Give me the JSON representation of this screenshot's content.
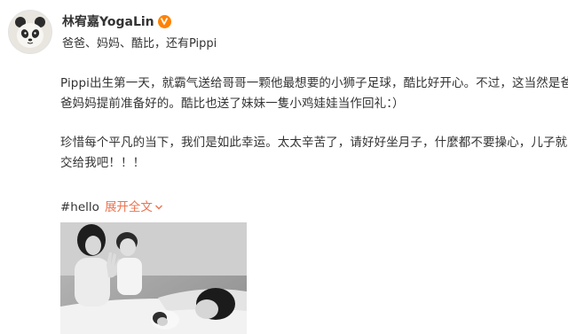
{
  "post": {
    "author": {
      "name": "林宥嘉YogaLin",
      "avatar_icon": "panda-avatar-icon",
      "badge_icon": "verified-badge-icon"
    },
    "subtitle": "爸爸、妈妈、酷比，还有Pippi",
    "paragraph1": [
      "Pippi出生第一天，就霸气送给哥哥一颗他最想要的小狮子足球，酷比好开心。不过，这当然是爸",
      "爸妈妈提前准备好的。酷比也送了妹妹一隻小鸡娃娃当作回礼：）"
    ],
    "paragraph2": [
      "珍惜每个平凡的当下，我们是如此幸运。太太辛苦了，请好好坐月子，什麼都不要操心，儿子就",
      "交给我吧！！！"
    ],
    "hashtag": "#hello",
    "expand_label": "展开全文",
    "photo_icon": "family-photo-icon"
  },
  "colors": {
    "link": "#eb7350",
    "badge": "#ff8200",
    "text": "#333333"
  }
}
